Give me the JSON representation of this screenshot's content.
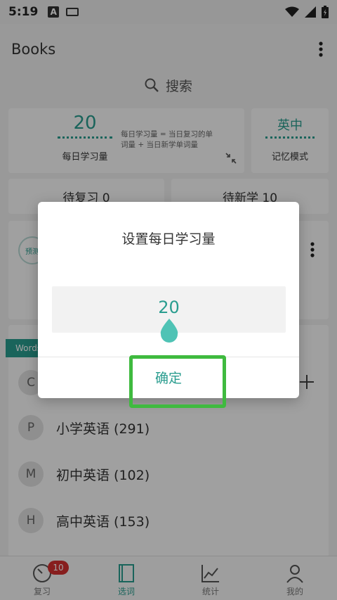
{
  "status_bar": {
    "time": "5:19",
    "notif_a": "A"
  },
  "app_bar": {
    "title": "Books"
  },
  "search": {
    "label": "搜索"
  },
  "daily": {
    "value": "20",
    "label": "每日学习量",
    "description": "每日学习量 = 当日复习的单词量 + 当日新学单词量"
  },
  "mode": {
    "value": "英中",
    "label": "记忆模式"
  },
  "counts": {
    "review": "待复习 0",
    "new_words": "待新学 10"
  },
  "book_card": {
    "preview": "预测"
  },
  "wordlists": {
    "tag": "Words",
    "first_letter": "C",
    "items": [
      {
        "letter": "P",
        "name": "小学英语 (291)"
      },
      {
        "letter": "M",
        "name": "初中英语 (102)"
      },
      {
        "letter": "H",
        "name": "高中英语 (153)"
      }
    ]
  },
  "bottom_nav": {
    "badge": "10",
    "items": [
      {
        "label": "复习",
        "icon": "clock-icon"
      },
      {
        "label": "选词",
        "icon": "book-icon"
      },
      {
        "label": "统计",
        "icon": "chart-icon"
      },
      {
        "label": "我的",
        "icon": "person-icon"
      }
    ]
  },
  "dialog": {
    "title": "设置每日学习量",
    "value": "20",
    "confirm": "确定"
  },
  "colors": {
    "accent": "#2a9d8f",
    "highlight": "#3fba3f",
    "badge": "#d32f2f"
  }
}
